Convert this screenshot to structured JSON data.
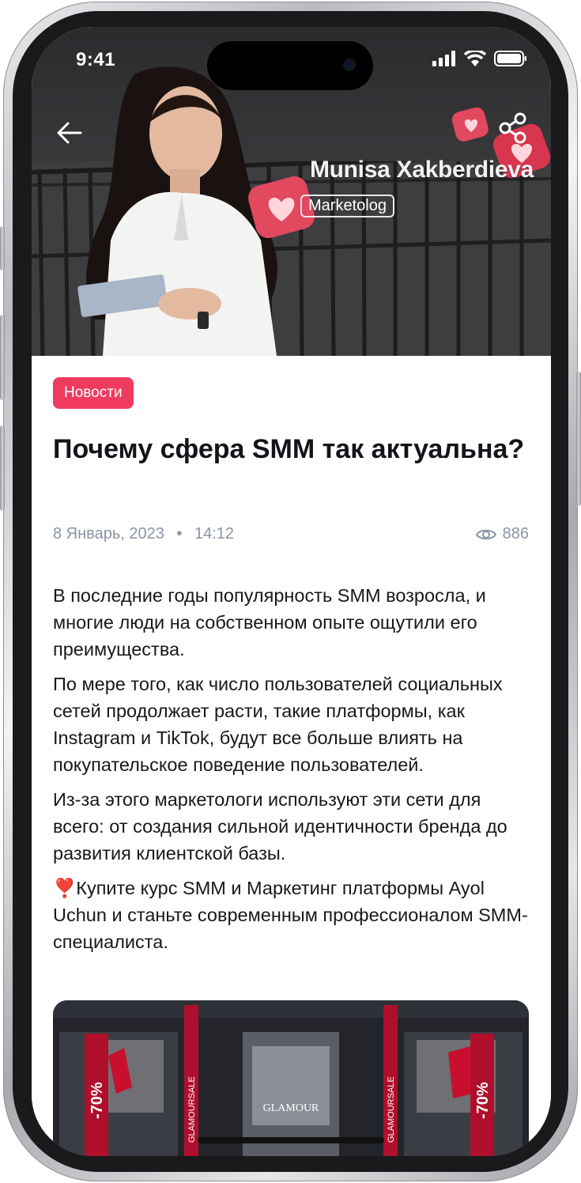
{
  "status_bar": {
    "time": "9:41"
  },
  "hero": {
    "author_name": "Munisa Xakberdieva",
    "author_role": "Marketolog"
  },
  "article": {
    "category": "Новости",
    "title": "Почему сфера SMM так актуальна?",
    "date": "8 Январь, 2023",
    "time": "14:12",
    "views": "886",
    "paragraphs": [
      "В последние годы популярность SMM возросла, и многие люди на собственном опыте ощутили его преимущества.",
      "По мере того, как число пользователей социальных сетей продолжает расти, такие платформы, как Instagram и TikTok, будут все больше влиять на покупательское поведение пользователей.",
      "Из-за этого маркетологи используют эти сети для всего: от создания сильной идентичности бренда до развития клиентской базы.",
      "❣️Купите курс SMM и Маркетинг платформы Ayol Uchun и станьте современным профессионалом SMM-специалиста."
    ]
  },
  "image": {
    "store_sign": "GLAMOUR",
    "banner_left": "-70%",
    "banner_right": "-70%",
    "vertical_banner_left": "GLAMOURSALE",
    "vertical_banner_right": "GLAMOURSALE"
  },
  "colors": {
    "accent": "#ef3b5f",
    "title": "#131419",
    "meta": "#8a94a6",
    "body": "#17181c"
  },
  "icons": {
    "back": "arrow-left-icon",
    "share": "share-icon",
    "views": "eye-icon",
    "signal": "cellular-signal-icon",
    "wifi": "wifi-icon",
    "battery": "battery-icon"
  }
}
